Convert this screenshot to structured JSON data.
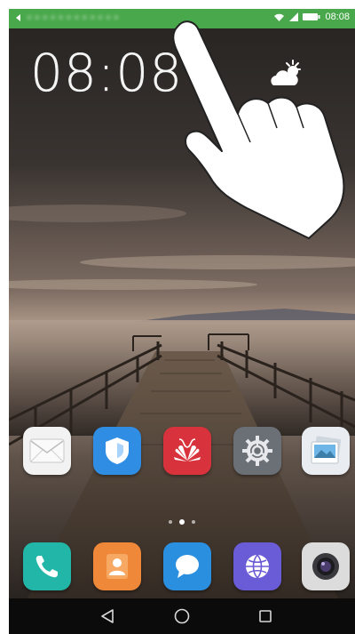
{
  "status_bar": {
    "notification_text": "• • • • • • • • • • • •",
    "time": "08:08",
    "icons": [
      "back-arrow-icon",
      "wifi-icon",
      "signal-icon",
      "battery-icon"
    ],
    "color": "#49a84b"
  },
  "clock_widget": {
    "time": "08:08"
  },
  "weather_widget": {
    "icon": "partly-sunny-icon"
  },
  "gesture_overlay": {
    "icon": "swipe-down-hand-icon"
  },
  "home_apps": [
    {
      "name": "email",
      "icon": "envelope-icon",
      "color": "#f2f2f2"
    },
    {
      "name": "phone-manager",
      "icon": "shield-icon",
      "color": "#2f8de4"
    },
    {
      "name": "huawei-themes",
      "icon": "huawei-logo-icon",
      "color": "#d8333c"
    },
    {
      "name": "settings",
      "icon": "gear-icon",
      "color": "#6b7077"
    },
    {
      "name": "gallery",
      "icon": "photo-icon",
      "color": "#e9edf1"
    }
  ],
  "page_indicator": {
    "count": 3,
    "active": 1
  },
  "dock_apps": [
    {
      "name": "phone",
      "icon": "phone-icon",
      "color": "#22b6a8"
    },
    {
      "name": "contacts",
      "icon": "contact-icon",
      "color": "#f0883a"
    },
    {
      "name": "messaging",
      "icon": "chat-bubble-icon",
      "color": "#2b8fe0"
    },
    {
      "name": "browser",
      "icon": "globe-icon",
      "color": "#6a5bd6"
    },
    {
      "name": "camera",
      "icon": "camera-icon",
      "color": "#dcdcdc"
    }
  ],
  "nav_bar": {
    "buttons": [
      "back-icon",
      "home-icon",
      "recents-icon"
    ]
  }
}
